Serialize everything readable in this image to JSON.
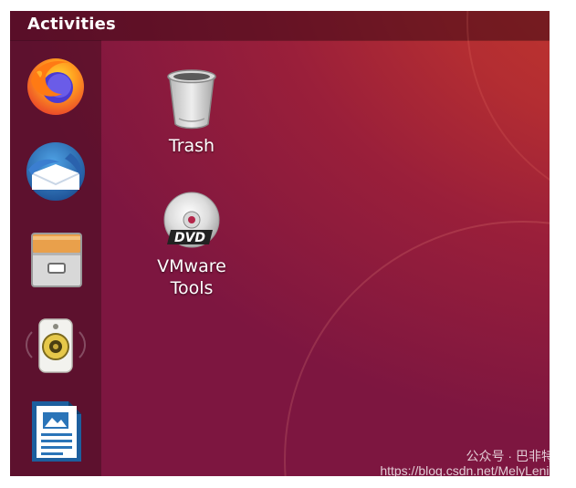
{
  "top_bar": {
    "activities_label": "Activities"
  },
  "dock": {
    "items": [
      {
        "name": "Firefox Web Browser",
        "icon": "firefox-icon"
      },
      {
        "name": "Thunderbird Mail",
        "icon": "thunderbird-icon"
      },
      {
        "name": "Files",
        "icon": "files-icon"
      },
      {
        "name": "Rhythmbox",
        "icon": "rhythmbox-icon"
      },
      {
        "name": "LibreOffice Writer",
        "icon": "writer-icon"
      }
    ]
  },
  "desktop": {
    "icons": [
      {
        "label": "Trash",
        "icon": "trash-icon"
      },
      {
        "label": "VMware\nTools",
        "icon": "dvd-icon"
      }
    ]
  },
  "watermark": {
    "line1": "公众号 · 巴非特链",
    "line2": "https://blog.csdn.net/MelyLenient"
  },
  "colors": {
    "wallpaper_orange": "#c73a2a",
    "wallpaper_purple": "#7d1640",
    "dock_bg": "#3a0a19",
    "text": "#ffffff"
  }
}
